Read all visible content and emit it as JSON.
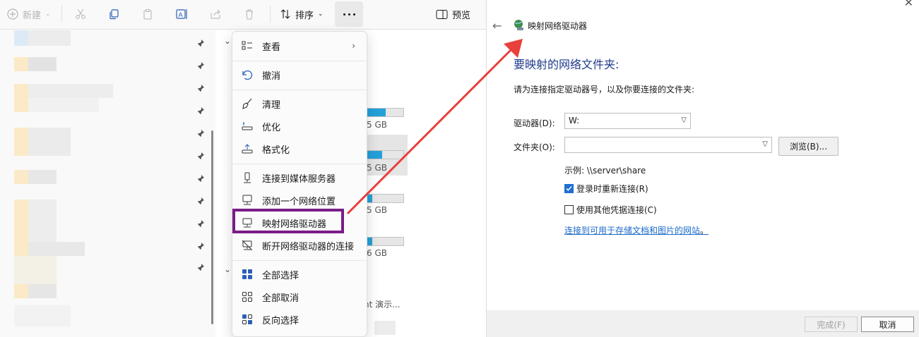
{
  "toolbar": {
    "new_label": "新建",
    "sort_label": "排序",
    "preview_label": "预览"
  },
  "content": {
    "drives": [
      {
        "size_text": "5 GB",
        "used_fraction": 0.55
      },
      {
        "size_text": "5 GB",
        "used_fraction": 0.45
      },
      {
        "size_text": "5 GB",
        "used_fraction": 0.2
      },
      {
        "size_text": "6 GB",
        "used_fraction": 0.2
      }
    ],
    "demo_text": "nt 演示..."
  },
  "menu": {
    "items": [
      {
        "label": "查看",
        "icon": "view-icon"
      },
      {
        "label": "撤消",
        "icon": "undo-icon"
      },
      {
        "label": "清理",
        "icon": "broom-icon"
      },
      {
        "label": "优化",
        "icon": "optimize-icon"
      },
      {
        "label": "格式化",
        "icon": "format-icon"
      },
      {
        "label": "连接到媒体服务器",
        "icon": "media-server-icon"
      },
      {
        "label": "添加一个网络位置",
        "icon": "network-location-icon"
      },
      {
        "label": "映射网络驱动器",
        "icon": "map-drive-icon"
      },
      {
        "label": "断开网络驱动器的连接",
        "icon": "disconnect-drive-icon"
      },
      {
        "label": "全部选择",
        "icon": "select-all-icon"
      },
      {
        "label": "全部取消",
        "icon": "select-none-icon"
      },
      {
        "label": "反向选择",
        "icon": "invert-selection-icon"
      }
    ]
  },
  "dialog": {
    "title": "映射网络驱动器",
    "heading": "要映射的网络文件夹:",
    "description": "请为连接指定驱动器号，以及你要连接的文件夹:",
    "drive_label": "驱动器(D):",
    "drive_value": "W:",
    "folder_label": "文件夹(O):",
    "folder_value": "",
    "browse_label": "浏览(B)...",
    "example_text": "示例: \\\\server\\share",
    "reconnect_label": "登录时重新连接(R)",
    "reconnect_checked": true,
    "other_credentials_label": "使用其他凭据连接(C)",
    "other_credentials_checked": false,
    "link_text": "连接到可用于存储文档和图片的网站",
    "link_suffix": "。",
    "finish_label": "完成(F)",
    "cancel_label": "取消"
  },
  "colors": {
    "accent": "#1e6fd0",
    "heading": "#1f3b8a",
    "highlight_box": "#7a1d86",
    "arrow": "#e8403c",
    "drive_fill": "#26a0da"
  }
}
